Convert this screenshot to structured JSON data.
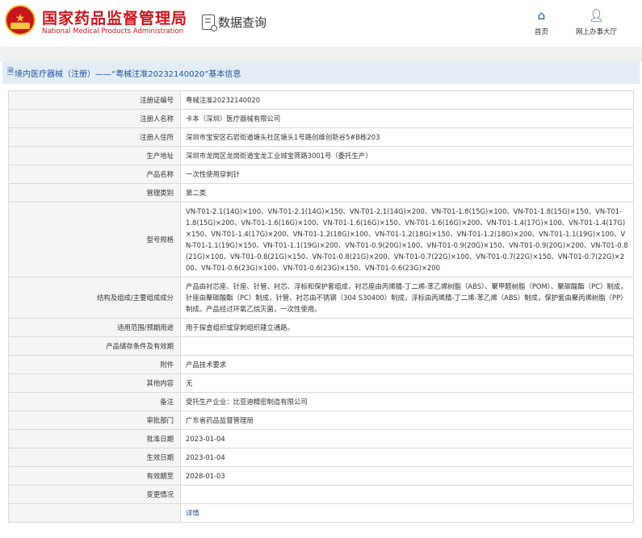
{
  "header": {
    "brand_cn": "国家药品监督管理局",
    "brand_en": "National Medical Products Administration",
    "query_label": "数据查询",
    "nav": {
      "home_label": "首页",
      "home_icon": "home-icon",
      "hall_label": "网上办事大厅",
      "hall_icon": "user-icon"
    }
  },
  "breadcrumb": {
    "text": "境内医疗器械（注册）——“粤械注准20232140020”基本信息"
  },
  "rows": [
    {
      "label": "注册证编号",
      "value": "粤械注准20232140020"
    },
    {
      "label": "注册人名称",
      "value": "卡本（深圳）医疗器械有限公司"
    },
    {
      "label": "注册人住所",
      "value": "深圳市宝安区石岩街道塘头社区塘头1号路创维创新谷5#B栋203"
    },
    {
      "label": "生产地址",
      "value": "深圳市龙岗区龙岗街道宝龙工业城宝荷路3001号（委托生产）"
    },
    {
      "label": "产品名称",
      "value": "一次性使用穿刺针"
    },
    {
      "label": "管理类别",
      "value": "第二类"
    },
    {
      "label": "型号规格",
      "value": "VN-T01-2.1(14G)×100、VN-T01-2.1(14G)×150、VN-T01-2.1(14G)×200、VN-T01-1.8(15G)×100、VN-T01-1.8(15G)×150、VN-T01-1.8(15G)×200、VN-T01-1.6(16G)×100、VN-T01-1.6(16G)×150、VN-T01-1.6(16G)×200、VN-T01-1.4(17G)×100、VN-T01-1.4(17G)×150、VN-T01-1.4(17G)×200、VN-T01-1.2(18G)×100、VN-T01-1.2(18G)×150、VN-T01-1.2(18G)×200、VN-T01-1.1(19G)×100、VN-T01-1.1(19G)×150、VN-T01-1.1(19G)×200、VN-T01-0.9(20G)×100、VN-T01-0.9(20G)×150、VN-T01-0.9(20G)×200、VN-T01-0.8(21G)×100、VN-T01-0.8(21G)×150、VN-T01-0.8(21G)×200、VN-T01-0.7(22G)×100、VN-T01-0.7(22G)×150、VN-T01-0.7(22G)×200、VN-T01-0.6(23G)×100、VN-T01-0.6(23G)×150、VN-T01-0.6(23G)×200"
    },
    {
      "label": "结构及组成/主要组成成分",
      "value": "产品由衬芯座、针座、针管、衬芯、浮标和保护套组成，衬芯座由丙烯腈-丁二烯-苯乙烯树脂（ABS）、聚甲醛树脂（POM）、聚碳酸酯（PC）制成，针座由聚碳酸酯（PC）制成，针管、衬芯由不锈钢（304 S30400）制成，浮标由丙烯腈-丁二烯-苯乙烯（ABS）制成，保护套由聚丙烯树脂（PP）制成。产品经过环氧乙烷灭菌，一次性使用。"
    },
    {
      "label": "适用范围/预期用途",
      "value": "用于探查组织或穿刺组织建立通路。"
    },
    {
      "label": "产品储存条件及有效期",
      "value": ""
    },
    {
      "label": "附件",
      "value": "产品技术要求"
    },
    {
      "label": "其他内容",
      "value": "无"
    },
    {
      "label": "备注",
      "value": "受托生产企业：比亚迪精密制造有限公司"
    },
    {
      "label": "审批部门",
      "value": "广东省药品监督管理局"
    },
    {
      "label": "批准日期",
      "value": "2023-01-04"
    },
    {
      "label": "生效日期",
      "value": "2023-01-04"
    },
    {
      "label": "有效期至",
      "value": "2028-01-03"
    },
    {
      "label": "变更情况",
      "value": ""
    },
    {
      "label": "",
      "value": "详情"
    }
  ]
}
